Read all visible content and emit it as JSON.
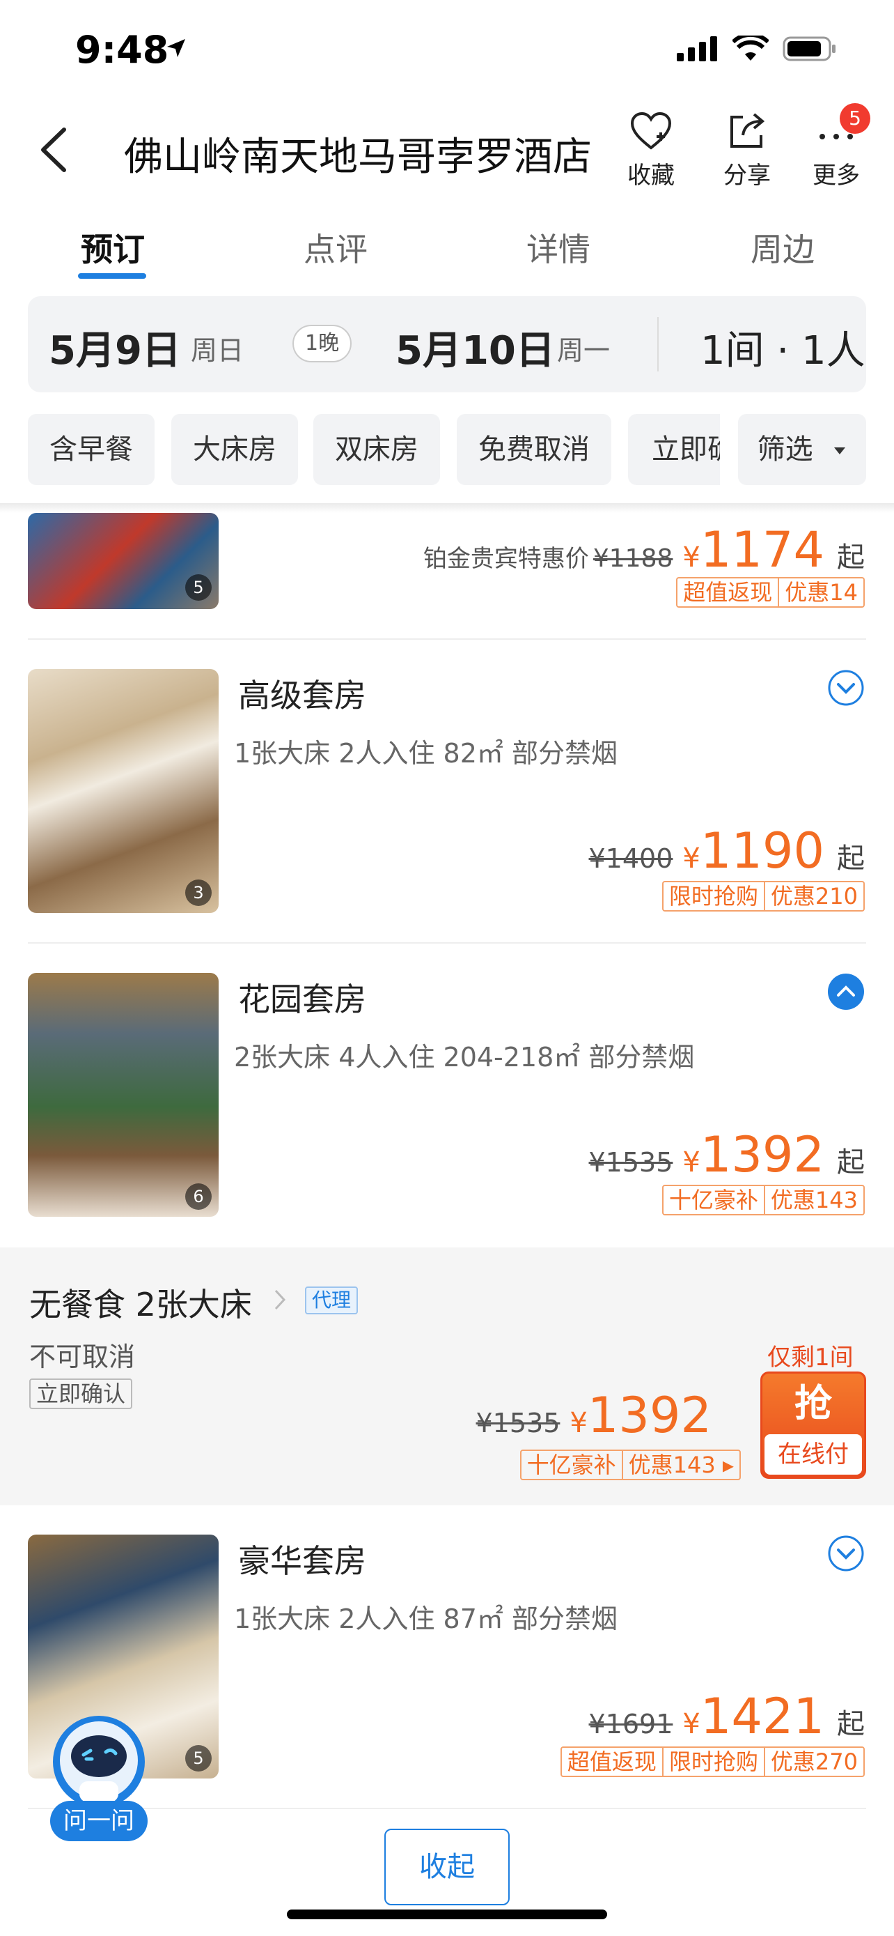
{
  "status_bar": {
    "time": "9:48"
  },
  "header": {
    "title": "佛山岭南天地马哥孛罗酒店",
    "favorite": "收藏",
    "share": "分享",
    "more": "更多",
    "more_badge": "5"
  },
  "tabs": [
    "预订",
    "点评",
    "详情",
    "周边"
  ],
  "date_bar": {
    "checkin": "5月9日",
    "checkin_week": "周日",
    "nights": "1晚",
    "checkout": "5月10日",
    "checkout_week": "周一",
    "rooms_guests": "1间 · 1人"
  },
  "filters": [
    "含早餐",
    "大床房",
    "双床房",
    "免费取消",
    "立即确",
    "筛选"
  ],
  "room_top": {
    "photo_count": "5",
    "member_label": "铂金贵宾特惠价",
    "orig_price": "¥1188",
    "price": "1174",
    "suffix": "起",
    "tags": [
      "超值返现",
      "优惠14"
    ]
  },
  "rooms": [
    {
      "name": "高级套房",
      "info": "1张大床  2人入住  82㎡  部分禁烟",
      "photo_count": "3",
      "orig_price": "¥1400",
      "price": "1190",
      "suffix": "起",
      "tags": [
        "限时抢购",
        "优惠210"
      ]
    },
    {
      "name": "花园套房",
      "info": "2张大床  4人入住  204-218㎡  部分禁烟",
      "photo_count": "6",
      "orig_price": "¥1535",
      "price": "1392",
      "suffix": "起",
      "tags": [
        "十亿豪补",
        "优惠143"
      ]
    },
    {
      "name": "豪华套房",
      "info": "1张大床  2人入住  87㎡  部分禁烟",
      "photo_count": "5",
      "orig_price": "¥1691",
      "price": "1421",
      "suffix": "起",
      "tags": [
        "超值返现",
        "限时抢购",
        "优惠270"
      ]
    }
  ],
  "plan": {
    "title": "无餐食 2张大床",
    "agent": "代理",
    "cancel": "不可取消",
    "confirm": "立即确认",
    "orig_price": "¥1535",
    "yen": "¥",
    "price": "1392",
    "tags": [
      "十亿豪补",
      "优惠143 ▸"
    ],
    "remaining": "仅剩1间",
    "grab": "抢",
    "pay": "在线付"
  },
  "assistant": {
    "label": "问一问"
  },
  "collapse_button": "收起",
  "colors": {
    "accent": "#1e7fe0",
    "price": "#f26c22",
    "badge": "#f13b2f"
  }
}
